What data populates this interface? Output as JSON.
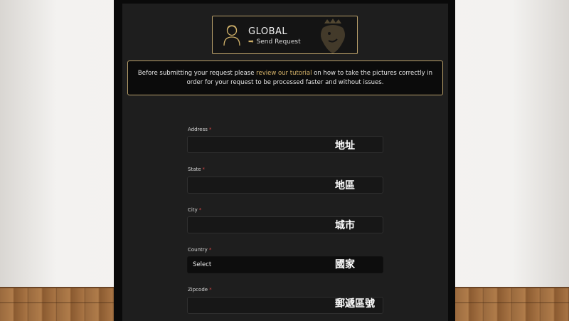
{
  "brand": {
    "title": "GLOBAL",
    "subtitle": "Send Request"
  },
  "notice": {
    "before": "Before submitting your request please ",
    "link": "review our tutorial",
    "after": " on how to take the pictures correctly in order for your request to be processed faster and without issues."
  },
  "form": {
    "required_mark": "*",
    "fields": [
      {
        "label": "Address",
        "value": "",
        "annotation": "地址"
      },
      {
        "label": "State",
        "value": "",
        "annotation": "地區"
      },
      {
        "label": "City",
        "value": "",
        "annotation": "城市"
      },
      {
        "label": "Country",
        "value": "Select",
        "annotation": "國家"
      },
      {
        "label": "Zipcode",
        "value": "",
        "annotation": "郵遞區號"
      }
    ]
  },
  "colors": {
    "accent_gold": "#b9a06a",
    "link_gold": "#d7b46a",
    "required_red": "#d94848",
    "panel_bg": "#1e1e1e"
  }
}
